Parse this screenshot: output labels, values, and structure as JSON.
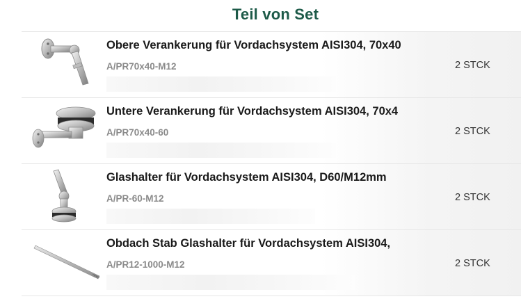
{
  "section_title": "Teil von Set",
  "items": [
    {
      "name": "Obere Verankerung für Vordachsystem AISI304, 70x40",
      "sku": "A/PR70x40-M12",
      "qty": "2 STCK",
      "icon": "upper-anchor-icon"
    },
    {
      "name": "Untere Verankerung für Vordachsystem AISI304, 70x4",
      "sku": "A/PR70x40-60",
      "qty": "2 STCK",
      "icon": "lower-anchor-icon"
    },
    {
      "name": "Glashalter für Vordachsystem AISI304, D60/M12mm",
      "sku": "A/PR-60-M12",
      "qty": "2 STCK",
      "icon": "glass-holder-icon"
    },
    {
      "name": "Obdach Stab Glashalter für Vordachsystem AISI304,",
      "sku": "A/PR12-1000-M12",
      "qty": "2 STCK",
      "icon": "rod-icon"
    }
  ]
}
